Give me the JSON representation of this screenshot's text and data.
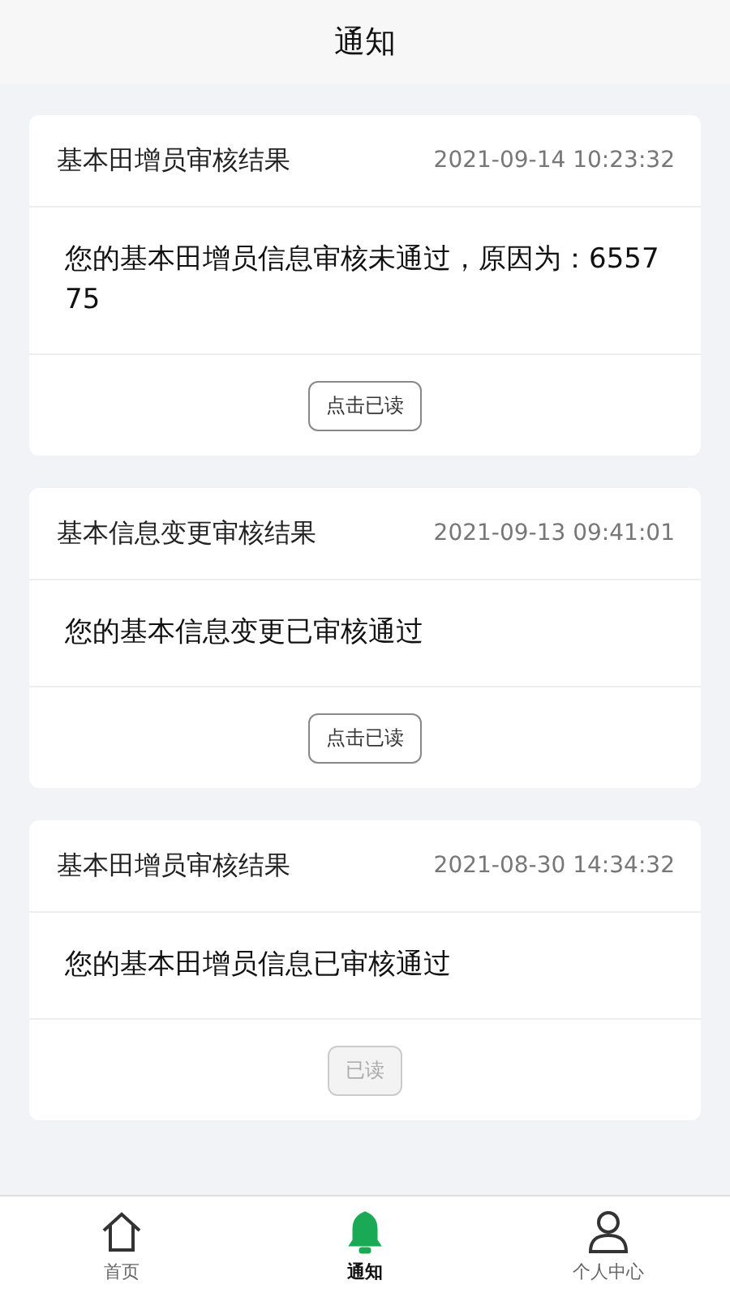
{
  "header": {
    "title": "通知"
  },
  "notifications": [
    {
      "title": "基本田增员审核结果",
      "time": "2021-09-14 10:23:32",
      "message": "您的基本田增员信息审核未通过，原因为：655775",
      "button": "点击已读",
      "read": false
    },
    {
      "title": "基本信息变更审核结果",
      "time": "2021-09-13 09:41:01",
      "message": "您的基本信息变更已审核通过",
      "button": "点击已读",
      "read": false
    },
    {
      "title": "基本田增员审核结果",
      "time": "2021-08-30 14:34:32",
      "message": "您的基本田增员信息已审核通过",
      "button": "已读",
      "read": true
    }
  ],
  "tab_bar": [
    {
      "kind": "home",
      "label": "首页",
      "selected": false
    },
    {
      "kind": "bell",
      "label": "通知",
      "selected": true
    },
    {
      "kind": "person",
      "label": "个人中心",
      "selected": false
    }
  ]
}
